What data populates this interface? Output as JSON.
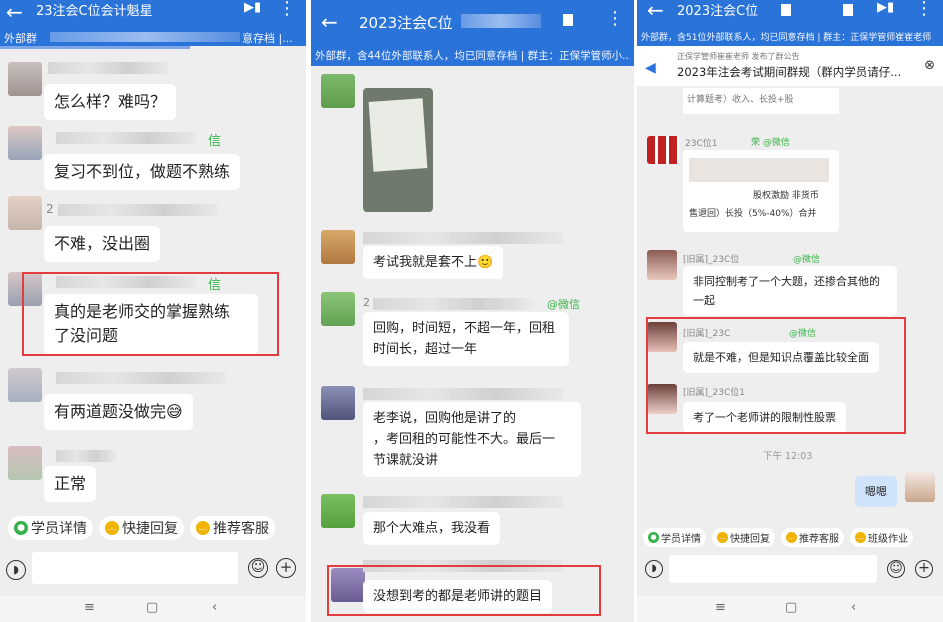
{
  "panel1": {
    "title": "23注会C位会计魁星",
    "subtitle_left": "外部群",
    "subtitle_right": "意存档 |...",
    "messages": [
      {
        "text": "怎么样？难吗？"
      },
      {
        "text": "复习不到位，做题不熟练",
        "tag": "信"
      },
      {
        "text": "不难，没出圈",
        "tag": "2"
      },
      {
        "text": "真的是老师交的掌握熟练",
        "text2": "了没问题",
        "tag": "信"
      },
      {
        "text": "有两道题没做完😅"
      },
      {
        "text": "正常"
      }
    ],
    "toolbar": [
      "学员详情",
      "快捷回复",
      "推荐客服"
    ],
    "nav": [
      "≡",
      "▢",
      "‹"
    ]
  },
  "panel2": {
    "title": "2023注会C位",
    "subtitle": "外部群，含44位外部联系人，均已同意存档 | 群主：正保学管师小...",
    "messages": [
      {
        "text": "考试我就是套不上🙂"
      },
      {
        "line1": "回购，时间短，不超一年，回租",
        "line2": "时间长，超过一年",
        "tag": "@微信",
        "pre": "2"
      },
      {
        "line1": "老李说，回购他是讲了的",
        "line2": "，考回租的可能性不大。最后一",
        "line3": "节课就没讲"
      },
      {
        "text": "那个大难点，我没看"
      },
      {
        "text": "没想到考的都是老师讲的题目"
      }
    ]
  },
  "panel3": {
    "title": "2023注会C位",
    "subtitle": "外部群，含51位外部联系人，均已同意存档 | 群主：正保学管师崔崔老师",
    "notice_from": "正保学管师崔崔老师 发布了群公告",
    "notice_text": "2023年注会考试期间群规（群内学员请仔...",
    "snippet_top": "计算题考）收入、长投+股",
    "snippet_name": "23C位1",
    "snippet_wx": "荣 @微信",
    "snippet_l1": "股权激励 非货币",
    "snippet_l2": "售退回）长投（5%-40%）合并",
    "msgs": [
      {
        "name": "[旧属]_23C位",
        "wx": "@微信",
        "line1": "非同控制考了一个大题，还掺合其他的",
        "line2": "一起"
      },
      {
        "name": "[旧属]_23C",
        "wx": "@微信",
        "text": "就是不难，但是知识点覆盖比较全面"
      },
      {
        "name": "[旧属]_23C位1",
        "wx": "",
        "text": "考了一个老师讲的限制性股票"
      }
    ],
    "time": "下午 12:03",
    "self_msg": "嗯嗯",
    "toolbar": [
      "学员详情",
      "快捷回复",
      "推荐客服",
      "班级作业"
    ],
    "nav": [
      "≡",
      "▢",
      "‹"
    ]
  },
  "icons": {
    "back": "←",
    "more": "⋮",
    "video": "📹",
    "voice": "🔊",
    "emoji": "☺",
    "plus": "+",
    "close": "⊗",
    "speaker": "🔈"
  },
  "colors": {
    "topbar": "#2a73d9",
    "highlight": "#e23c3c",
    "wechat_green": "#3bb44a"
  }
}
